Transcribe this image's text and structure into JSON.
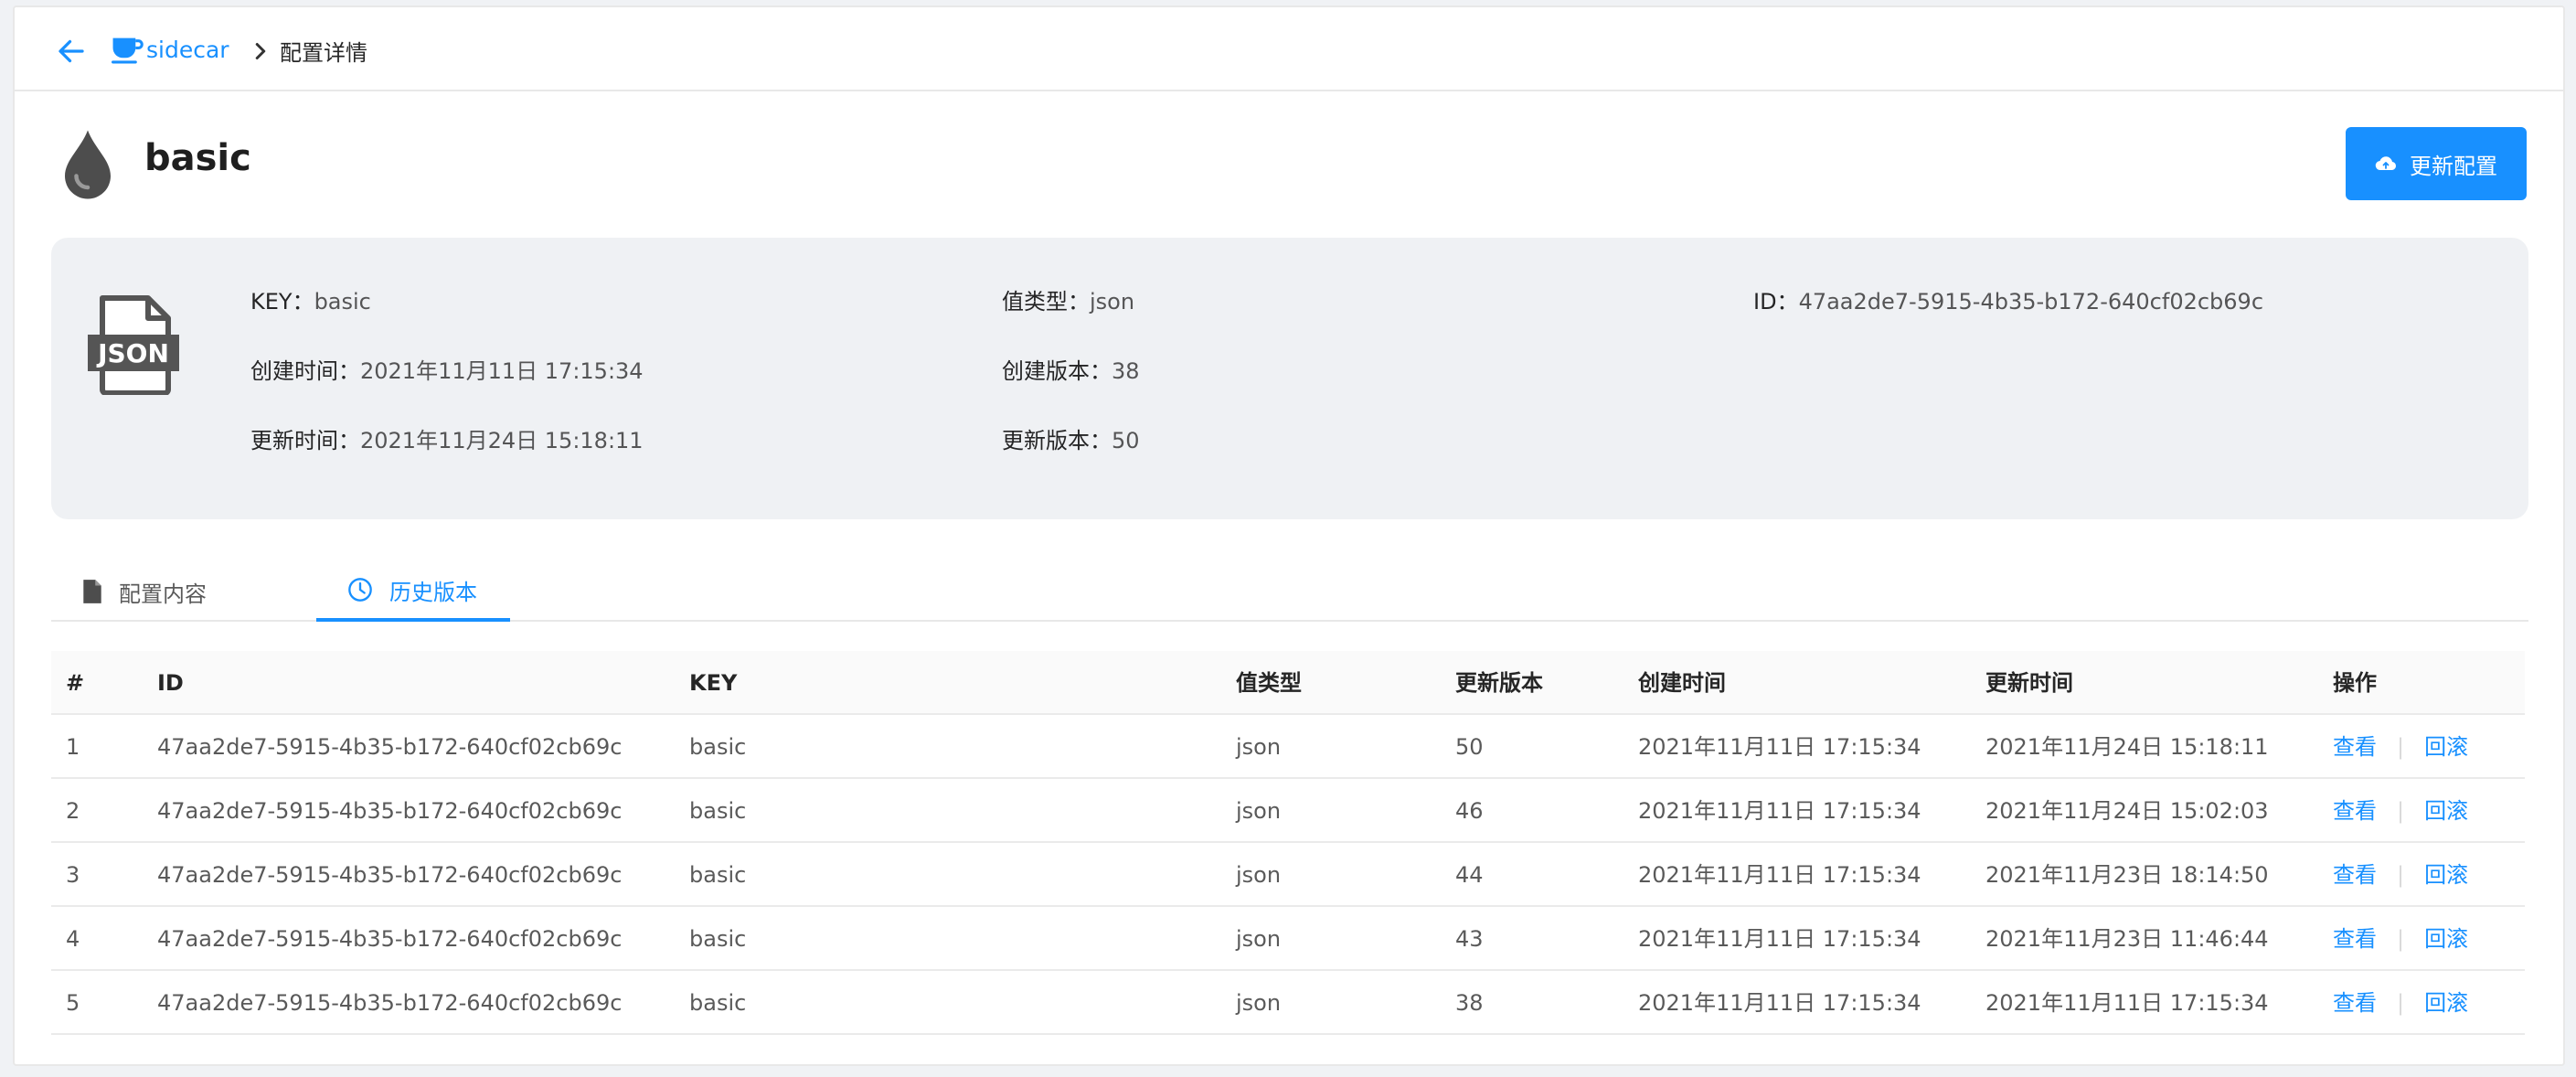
{
  "breadcrumb": {
    "app": "sidecar",
    "current": "配置详情"
  },
  "title": "basic",
  "update_button": "更新配置",
  "info": {
    "key_label": "KEY：",
    "key_value": "basic",
    "created_time_label": "创建时间：",
    "created_time_value": "2021年11月11日 17:15:34",
    "updated_time_label": "更新时间：",
    "updated_time_value": "2021年11月24日 15:18:11",
    "value_type_label": "值类型：",
    "value_type_value": "json",
    "created_version_label": "创建版本：",
    "created_version_value": "38",
    "updated_version_label": "更新版本：",
    "updated_version_value": "50",
    "id_label": "ID：",
    "id_value": "47aa2de7-5915-4b35-b172-640cf02cb69c",
    "file_icon_text": "JSON"
  },
  "tabs": [
    {
      "label": "配置内容",
      "icon": "file-icon"
    },
    {
      "label": "历史版本",
      "icon": "clock-icon"
    }
  ],
  "table": {
    "headers": [
      "#",
      "ID",
      "KEY",
      "值类型",
      "更新版本",
      "创建时间",
      "更新时间",
      "操作"
    ],
    "rows": [
      {
        "n": "1",
        "id": "47aa2de7-5915-4b35-b172-640cf02cb69c",
        "key": "basic",
        "type": "json",
        "version": "50",
        "created": "2021年11月11日 17:15:34",
        "updated": "2021年11月24日 15:18:11"
      },
      {
        "n": "2",
        "id": "47aa2de7-5915-4b35-b172-640cf02cb69c",
        "key": "basic",
        "type": "json",
        "version": "46",
        "created": "2021年11月11日 17:15:34",
        "updated": "2021年11月24日 15:02:03"
      },
      {
        "n": "3",
        "id": "47aa2de7-5915-4b35-b172-640cf02cb69c",
        "key": "basic",
        "type": "json",
        "version": "44",
        "created": "2021年11月11日 17:15:34",
        "updated": "2021年11月23日 18:14:50"
      },
      {
        "n": "4",
        "id": "47aa2de7-5915-4b35-b172-640cf02cb69c",
        "key": "basic",
        "type": "json",
        "version": "43",
        "created": "2021年11月11日 17:15:34",
        "updated": "2021年11月23日 11:46:44"
      },
      {
        "n": "5",
        "id": "47aa2de7-5915-4b35-b172-640cf02cb69c",
        "key": "basic",
        "type": "json",
        "version": "38",
        "created": "2021年11月11日 17:15:34",
        "updated": "2021年11月11日 17:15:34"
      }
    ],
    "actions": {
      "view": "查看",
      "rollback": "回滚",
      "separator": "|"
    }
  },
  "colors": {
    "accent": "#1890ff",
    "panel": "#eff1f4"
  }
}
